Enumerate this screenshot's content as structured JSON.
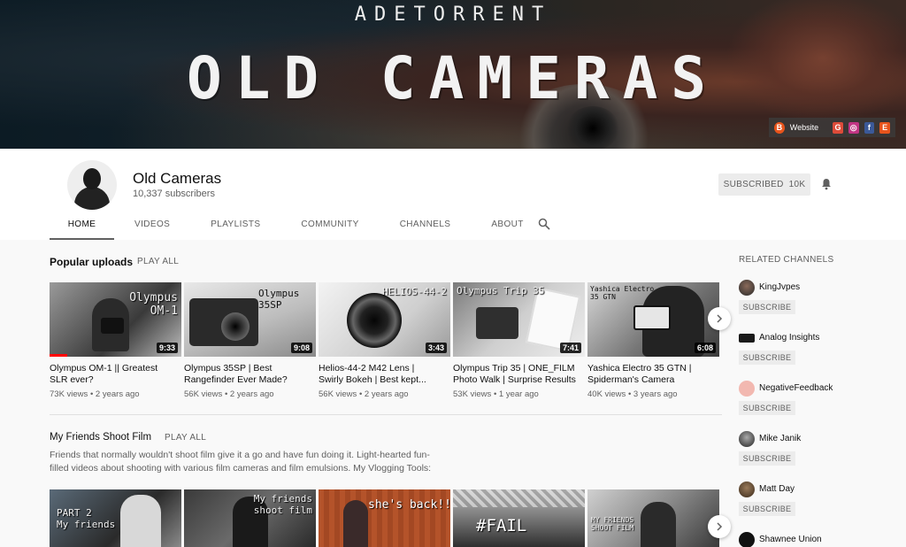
{
  "banner": {
    "top_text": "ADETORRENT",
    "title": "OLD CAMERAS",
    "website_label": "Website"
  },
  "channel": {
    "name": "Old Cameras",
    "subscribers": "10,337 subscribers",
    "subscribe_label": "SUBSCRIBED",
    "subscribe_count": "10K"
  },
  "tabs": [
    "HOME",
    "VIDEOS",
    "PLAYLISTS",
    "COMMUNITY",
    "CHANNELS",
    "ABOUT"
  ],
  "popular": {
    "title": "Popular uploads",
    "play_all": "PLAY ALL",
    "videos": [
      {
        "title_line1": "Olympus OM-1 || Greatest",
        "title_line2": "SLR ever?",
        "views": "73K views",
        "age": "2 years ago",
        "duration": "9:33",
        "caption": "Olympus\nOM-1"
      },
      {
        "title_line1": "Olympus 35SP | Best",
        "title_line2": "Rangefinder Ever Made?",
        "views": "56K views",
        "age": "2 years ago",
        "duration": "9:08",
        "caption": "Olympus\n35SP"
      },
      {
        "title_line1": "Helios-44-2 M42 Lens |",
        "title_line2": "Swirly Bokeh | Best kept...",
        "views": "56K views",
        "age": "2 years ago",
        "duration": "3:43",
        "caption": "HELIOS-44-2"
      },
      {
        "title_line1": "Olympus Trip 35 | ONE_FILM",
        "title_line2": "Photo Walk | Surprise Results",
        "views": "53K views",
        "age": "1 year ago",
        "duration": "7:41",
        "caption": "Olympus Trip 35"
      },
      {
        "title_line1": "Yashica Electro 35 GTN |",
        "title_line2": "Spiderman's Camera",
        "views": "40K views",
        "age": "3 years ago",
        "duration": "6:08",
        "caption": "Yashica Electro\n35 GTN"
      }
    ]
  },
  "friends": {
    "title": "My Friends Shoot Film",
    "play_all": "PLAY ALL",
    "description": "Friends that normally wouldn't shoot film give it a go and have fun doing it. Light-hearted fun-filled videos about shooting with various film cameras and film emulsions. My Vlogging Tools:",
    "captions": [
      "PART 2\nMy friends",
      "My friends\nshoot film",
      "she's back!!",
      "#FAIL",
      "MY FRIENDS\nSHOOT FILM"
    ]
  },
  "related": {
    "heading": "RELATED CHANNELS",
    "subscribe_label": "SUBSCRIBE",
    "channels": [
      "KingJvpes",
      "Analog Insights",
      "NegativeFeedback",
      "Mike Janik",
      "Matt Day",
      "Shawnee Union"
    ]
  }
}
